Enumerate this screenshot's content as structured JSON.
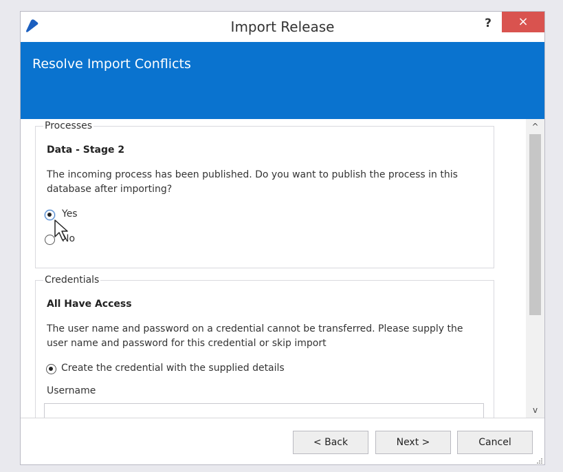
{
  "window": {
    "title": "Import Release",
    "help_label": "?",
    "close_label": "×"
  },
  "banner": {
    "title": "Resolve Import Conflicts"
  },
  "processes": {
    "legend": "Processes",
    "heading": "Data - Stage 2",
    "text": "The incoming process has been published. Do you want to publish the process in this database after importing?",
    "options": [
      {
        "label": "Yes",
        "selected": true
      },
      {
        "label": "No",
        "selected": false
      }
    ]
  },
  "credentials": {
    "legend": "Credentials",
    "heading": "All Have Access",
    "text": "The user name and password on a credential cannot be transferred. Please supply the user name and password for this credential or skip import",
    "option_label": "Create the credential with the supplied details",
    "username_label": "Username",
    "username_value": ""
  },
  "scrollbar": {
    "up_icon": "chevron-up-icon",
    "down_icon": "chevron-down-icon",
    "up_glyph": "^",
    "down_glyph": "v"
  },
  "footer": {
    "back_label": "< Back",
    "next_label": "Next >",
    "cancel_label": "Cancel"
  },
  "colors": {
    "accent": "#0a73cf",
    "close": "#d9534f"
  }
}
